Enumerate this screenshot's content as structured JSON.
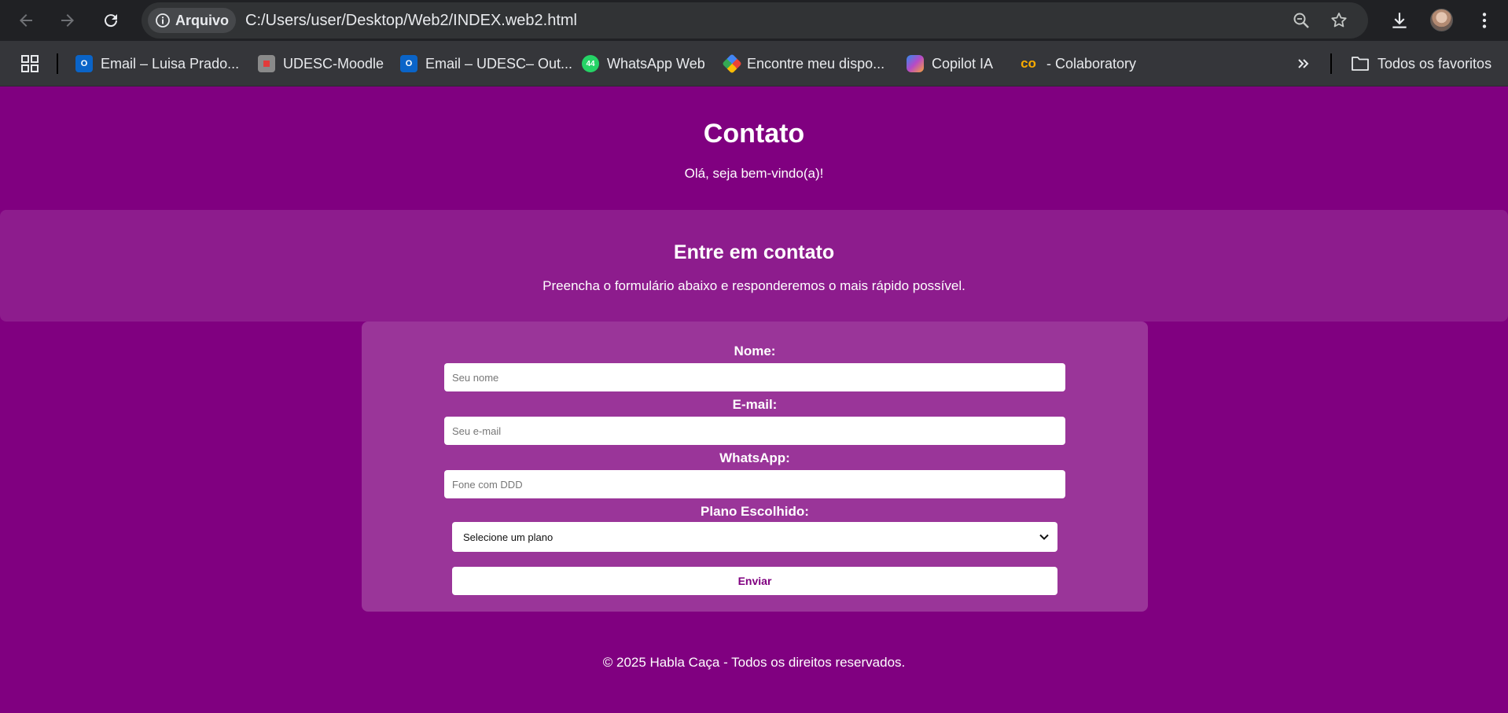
{
  "browser": {
    "site_chip_label": "Arquivo",
    "url": "C:/Users/user/Desktop/Web2/INDEX.web2.html",
    "bookmarks": [
      {
        "label": "Email – Luisa Prado...",
        "icon": "outlook-icon",
        "color": "#0a64c8"
      },
      {
        "label": "UDESC-Moodle",
        "icon": "udesc-icon",
        "color": "#8a8a8a"
      },
      {
        "label": "Email – UDESC– Out...",
        "icon": "outlook-icon",
        "color": "#0a64c8"
      },
      {
        "label": "WhatsApp Web",
        "icon": "whatsapp-icon",
        "color": "#25d366",
        "badge": "44"
      },
      {
        "label": "Encontre meu dispo...",
        "icon": "find-device-icon",
        "color": "#4285f4"
      },
      {
        "label": "Copilot IA",
        "icon": "copilot-icon",
        "color": "#b74ac6"
      },
      {
        "label": "- Colaboratory",
        "icon": "colab-icon",
        "color": "#f9ab00"
      }
    ],
    "all_bookmarks_label": "Todos os favoritos"
  },
  "page": {
    "title": "Contato",
    "subtitle": "Olá, seja bem-vindo(a)!",
    "section_title": "Entre em contato",
    "section_text": "Preencha o formulário abaixo e responderemos o mais rápido possível.",
    "form": {
      "name_label": "Nome:",
      "name_placeholder": "Seu nome",
      "email_label": "E-mail:",
      "email_placeholder": "Seu e-mail",
      "whatsapp_label": "WhatsApp:",
      "whatsapp_placeholder": "Fone com DDD",
      "plan_label": "Plano Escolhido:",
      "plan_selected": "Selecione um plano",
      "submit_label": "Enviar"
    },
    "footer": "© 2025 Habla Caça - Todos os direitos reservados."
  },
  "colors": {
    "page_bg": "#800080",
    "band_bg": "#8d1c8d",
    "form_bg": "#9a3599",
    "button_text": "#800080"
  }
}
